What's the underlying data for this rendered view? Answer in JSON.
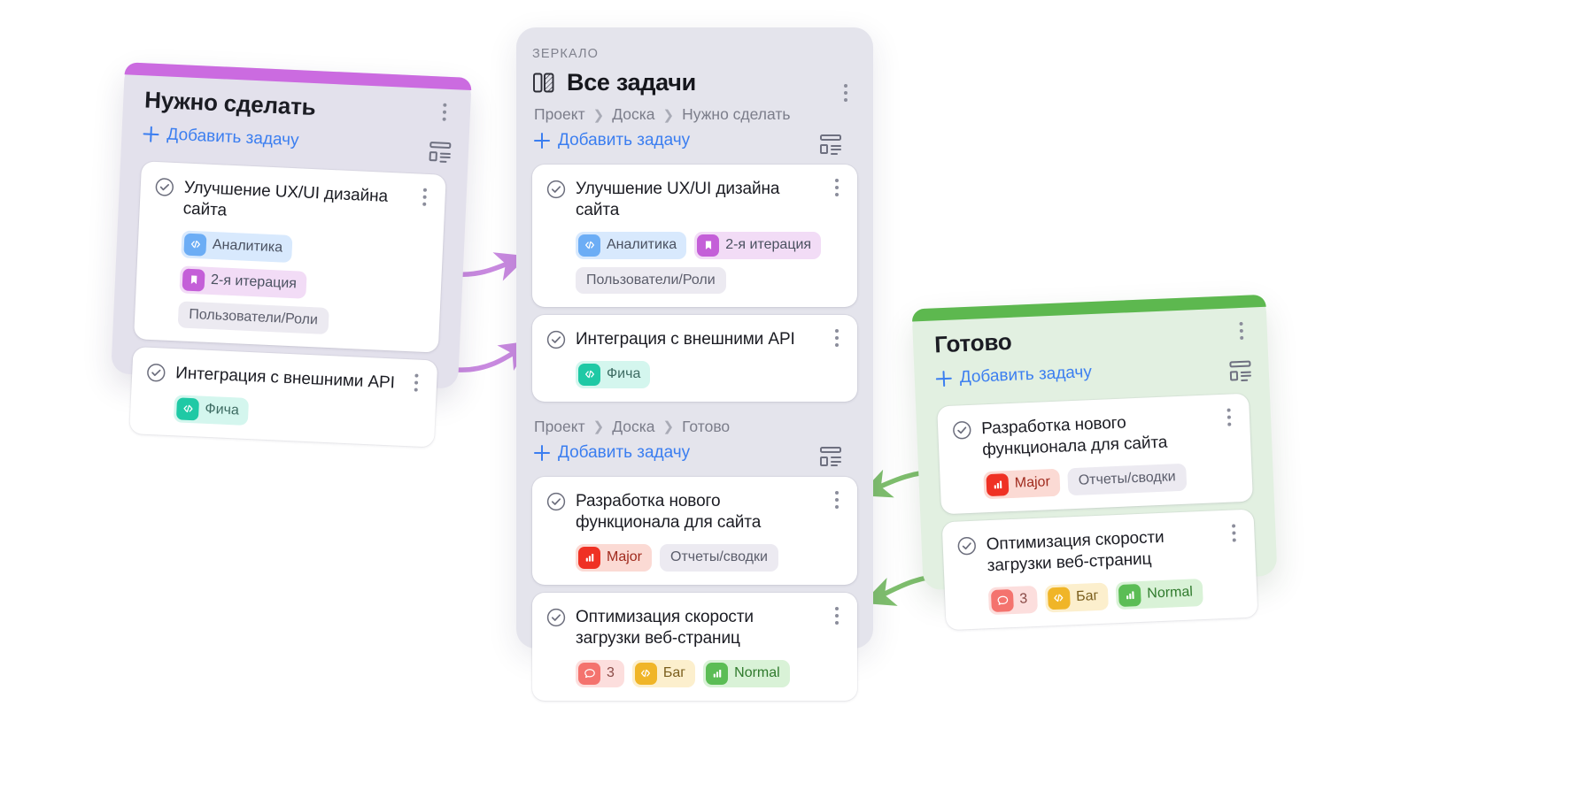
{
  "colors": {
    "accent_purple": "#cb6be0",
    "accent_green": "#5db84f",
    "link_blue": "#3b7ef0",
    "mirror_bg": "#e4e4ec",
    "todo_bg": "#e3e1ec",
    "done_bg": "#e2f0e1"
  },
  "todo_panel": {
    "title": "Нужно сделать",
    "add_label": "Добавить задачу",
    "menu_icon": "kebab-menu-icon",
    "layout_icon": "layout-grid-icon",
    "cards": [
      {
        "title": "Улучшение UX/UI дизайна сайта",
        "check_icon": "check-circle-icon",
        "tags": [
          {
            "label": "Аналитика",
            "icon": "code-icon",
            "icon_bg": "#6cadf5",
            "bg": "#d8e9fd",
            "fg": "#4a5160"
          },
          {
            "label": "2-я итерация",
            "icon": "bookmark-icon",
            "icon_bg": "#c45fd8",
            "bg": "#f2dcf6",
            "fg": "#4a5160"
          },
          {
            "label": "Пользователи/Роли",
            "icon": null,
            "bg": "#eceaf1",
            "fg": "#5b5d6b"
          }
        ]
      },
      {
        "title": "Интеграция с внешними API",
        "check_icon": "check-circle-icon",
        "tags": [
          {
            "label": "Фича",
            "icon": "code-icon",
            "icon_bg": "#1fc9a5",
            "bg": "#d4f6ee",
            "fg": "#3d6b62"
          }
        ]
      }
    ]
  },
  "mirror_panel": {
    "eyebrow": "ЗЕРКАЛО",
    "title": "Все задачи",
    "title_icon": "board-columns-icon",
    "menu_icon": "kebab-menu-icon",
    "sections": [
      {
        "breadcrumb": [
          "Проект",
          "Доска",
          "Нужно сделать"
        ],
        "add_label": "Добавить задачу",
        "layout_icon": "layout-grid-icon",
        "cards": [
          {
            "title": "Улучшение UX/UI дизайна сайта",
            "check_icon": "check-circle-icon",
            "menu_icon": "kebab-menu-icon",
            "tags": [
              {
                "label": "Аналитика",
                "icon": "code-icon",
                "icon_bg": "#6cadf5",
                "bg": "#d8e9fd",
                "fg": "#4a5160"
              },
              {
                "label": "2-я итерация",
                "icon": "bookmark-icon",
                "icon_bg": "#c45fd8",
                "bg": "#f2dcf6",
                "fg": "#4a5160"
              },
              {
                "label": "Пользователи/Роли",
                "icon": null,
                "bg": "#eceaf1",
                "fg": "#5b5d6b"
              }
            ]
          },
          {
            "title": "Интеграция с внешними API",
            "check_icon": "check-circle-icon",
            "menu_icon": "kebab-menu-icon",
            "tags": [
              {
                "label": "Фича",
                "icon": "code-icon",
                "icon_bg": "#1fc9a5",
                "bg": "#d4f6ee",
                "fg": "#3d6b62"
              }
            ]
          }
        ]
      },
      {
        "breadcrumb": [
          "Проект",
          "Доска",
          "Готово"
        ],
        "add_label": "Добавить задачу",
        "layout_icon": "layout-grid-icon",
        "cards": [
          {
            "title": "Разработка нового функционала для сайта",
            "check_icon": "check-circle-icon",
            "menu_icon": "kebab-menu-icon",
            "tags": [
              {
                "label": "Major",
                "icon": "bar-chart-icon",
                "icon_bg": "#ef3124",
                "bg": "#fbdad4",
                "fg": "#a02a1d"
              },
              {
                "label": "Отчеты/сводки",
                "icon": null,
                "bg": "#eceaf1",
                "fg": "#5b5d6b"
              }
            ]
          },
          {
            "title": "Оптимизация скорости загрузки веб-страниц",
            "check_icon": "check-circle-icon",
            "menu_icon": "kebab-menu-icon",
            "tags": [
              {
                "label": "3",
                "icon": "comment-icon",
                "icon_bg": "#f4736e",
                "bg": "#fcdedd",
                "fg": "#8a4b47"
              },
              {
                "label": "Баг",
                "icon": "code-icon",
                "icon_bg": "#f0b528",
                "bg": "#fcefcd",
                "fg": "#7a5e1c"
              },
              {
                "label": "Normal",
                "icon": "bar-chart-icon",
                "icon_bg": "#5bbd55",
                "bg": "#d9f2d7",
                "fg": "#2f7a2c"
              }
            ]
          }
        ]
      }
    ]
  },
  "done_panel": {
    "title": "Готово",
    "add_label": "Добавить задачу",
    "menu_icon": "kebab-menu-icon",
    "layout_icon": "layout-grid-icon",
    "cards": [
      {
        "title": "Разработка нового функционала для сайта",
        "check_icon": "check-circle-icon",
        "menu_icon": "kebab-menu-icon",
        "tags": [
          {
            "label": "Major",
            "icon": "bar-chart-icon",
            "icon_bg": "#ef3124",
            "bg": "#fbdad4",
            "fg": "#a02a1d"
          },
          {
            "label": "Отчеты/сводки",
            "icon": null,
            "bg": "#eceaf1",
            "fg": "#5b5d6b"
          }
        ]
      },
      {
        "title": "Оптимизация скорости загрузки веб-страниц",
        "check_icon": "check-circle-icon",
        "menu_icon": "kebab-menu-icon",
        "tags": [
          {
            "label": "3",
            "icon": "comment-icon",
            "icon_bg": "#f4736e",
            "bg": "#fcdedd",
            "fg": "#8a4b47"
          },
          {
            "label": "Баг",
            "icon": "code-icon",
            "icon_bg": "#f0b528",
            "bg": "#fcefcd",
            "fg": "#7a5e1c"
          },
          {
            "label": "Normal",
            "icon": "bar-chart-icon",
            "icon_bg": "#5bbd55",
            "bg": "#d9f2d7",
            "fg": "#2f7a2c"
          }
        ]
      }
    ]
  },
  "arrows": [
    {
      "name": "arrow-todo-card1-to-mirror",
      "color": "#c98ae0"
    },
    {
      "name": "arrow-todo-card2-to-mirror",
      "color": "#c98ae0"
    },
    {
      "name": "arrow-mirror-to-done-card1",
      "color": "#7fbf6e"
    },
    {
      "name": "arrow-mirror-to-done-card2",
      "color": "#7fbf6e"
    }
  ]
}
